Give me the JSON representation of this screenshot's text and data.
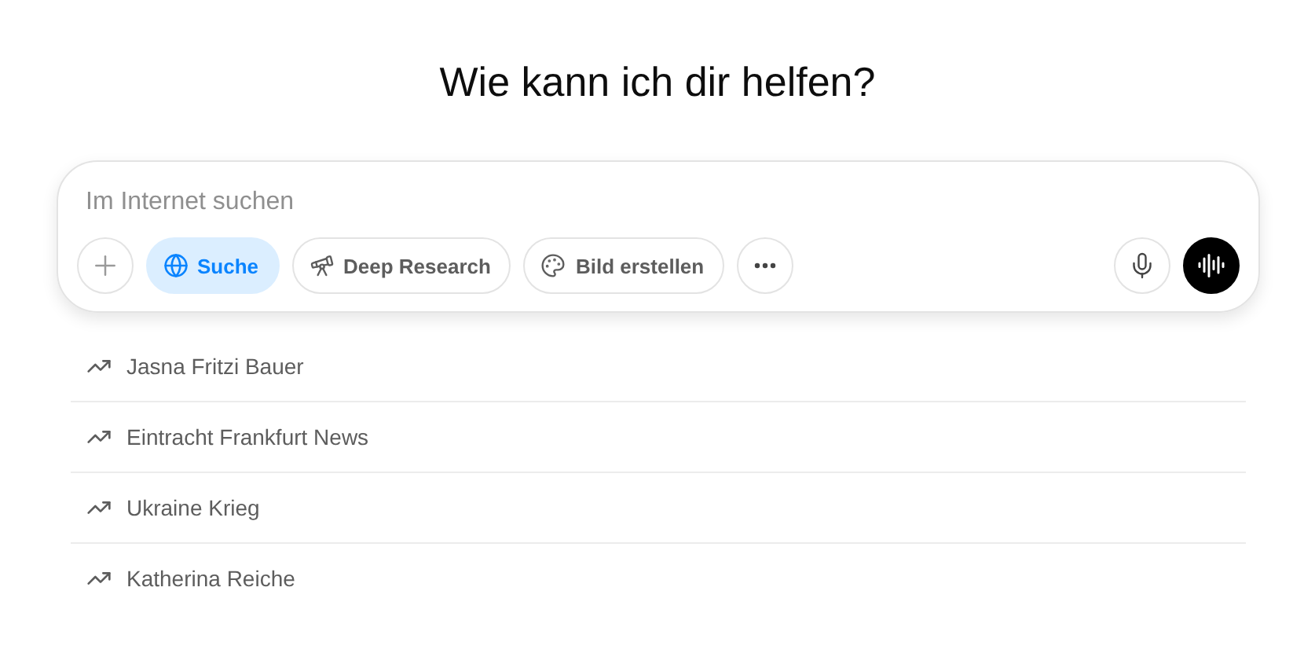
{
  "heading": "Wie kann ich dir helfen?",
  "composer": {
    "placeholder": "Im Internet suchen",
    "tools": [
      {
        "label": "Suche",
        "kind": "globe",
        "selected": true
      },
      {
        "label": "Deep Research",
        "kind": "telescope",
        "selected": false
      },
      {
        "label": "Bild erstellen",
        "kind": "palette",
        "selected": false
      }
    ]
  },
  "suggestions": [
    {
      "label": "Jasna Fritzi Bauer"
    },
    {
      "label": "Eintracht Frankfurt News"
    },
    {
      "label": "Ukraine Krieg"
    },
    {
      "label": "Katherina Reiche"
    }
  ]
}
